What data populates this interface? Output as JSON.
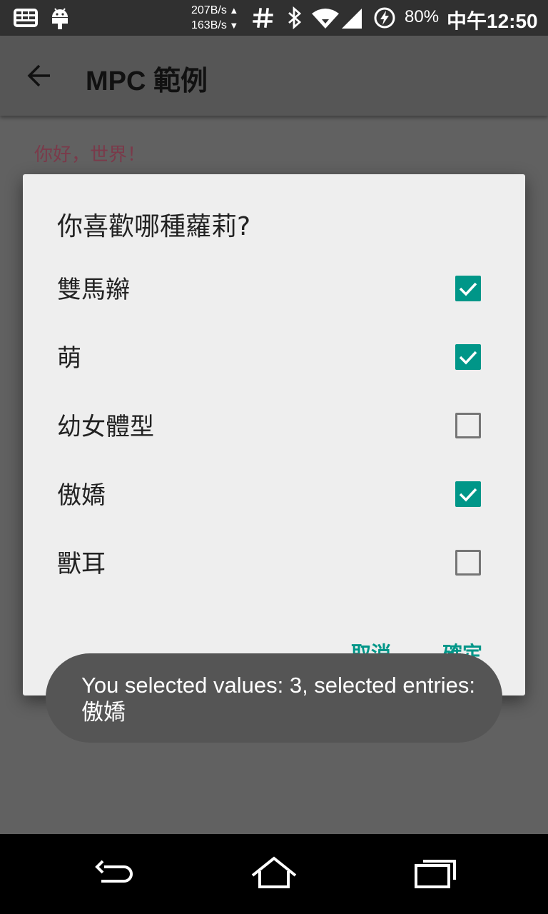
{
  "status_bar": {
    "net_up": "207B/s",
    "net_down": "163B/s",
    "battery": "80%",
    "time": "中午12:50",
    "icons": [
      "keyboard-icon",
      "android-debug-icon",
      "hash-icon",
      "bluetooth-icon",
      "wifi-icon",
      "signal-icon",
      "battery-charging-icon"
    ]
  },
  "toolbar": {
    "title": "MPC 範例",
    "back_icon": "arrow-back-icon"
  },
  "content": {
    "text": "你好，世界！"
  },
  "dialog": {
    "title": "你喜歡哪種蘿莉?",
    "items": [
      {
        "label": "雙馬辮",
        "checked": true
      },
      {
        "label": "萌",
        "checked": true
      },
      {
        "label": "幼女體型",
        "checked": false
      },
      {
        "label": "傲嬌",
        "checked": true
      },
      {
        "label": "獸耳",
        "checked": false
      }
    ],
    "cancel_label": "取消",
    "ok_label": "確定"
  },
  "toast": {
    "text": "You selected values: 3, selected entries: 傲嬌"
  },
  "nav_bar": {
    "icons": [
      "back-nav-icon",
      "home-nav-icon",
      "recents-nav-icon"
    ]
  },
  "colors": {
    "accent": "#009688",
    "scrim": "#616161",
    "dialog_bg": "#eeeeee"
  }
}
